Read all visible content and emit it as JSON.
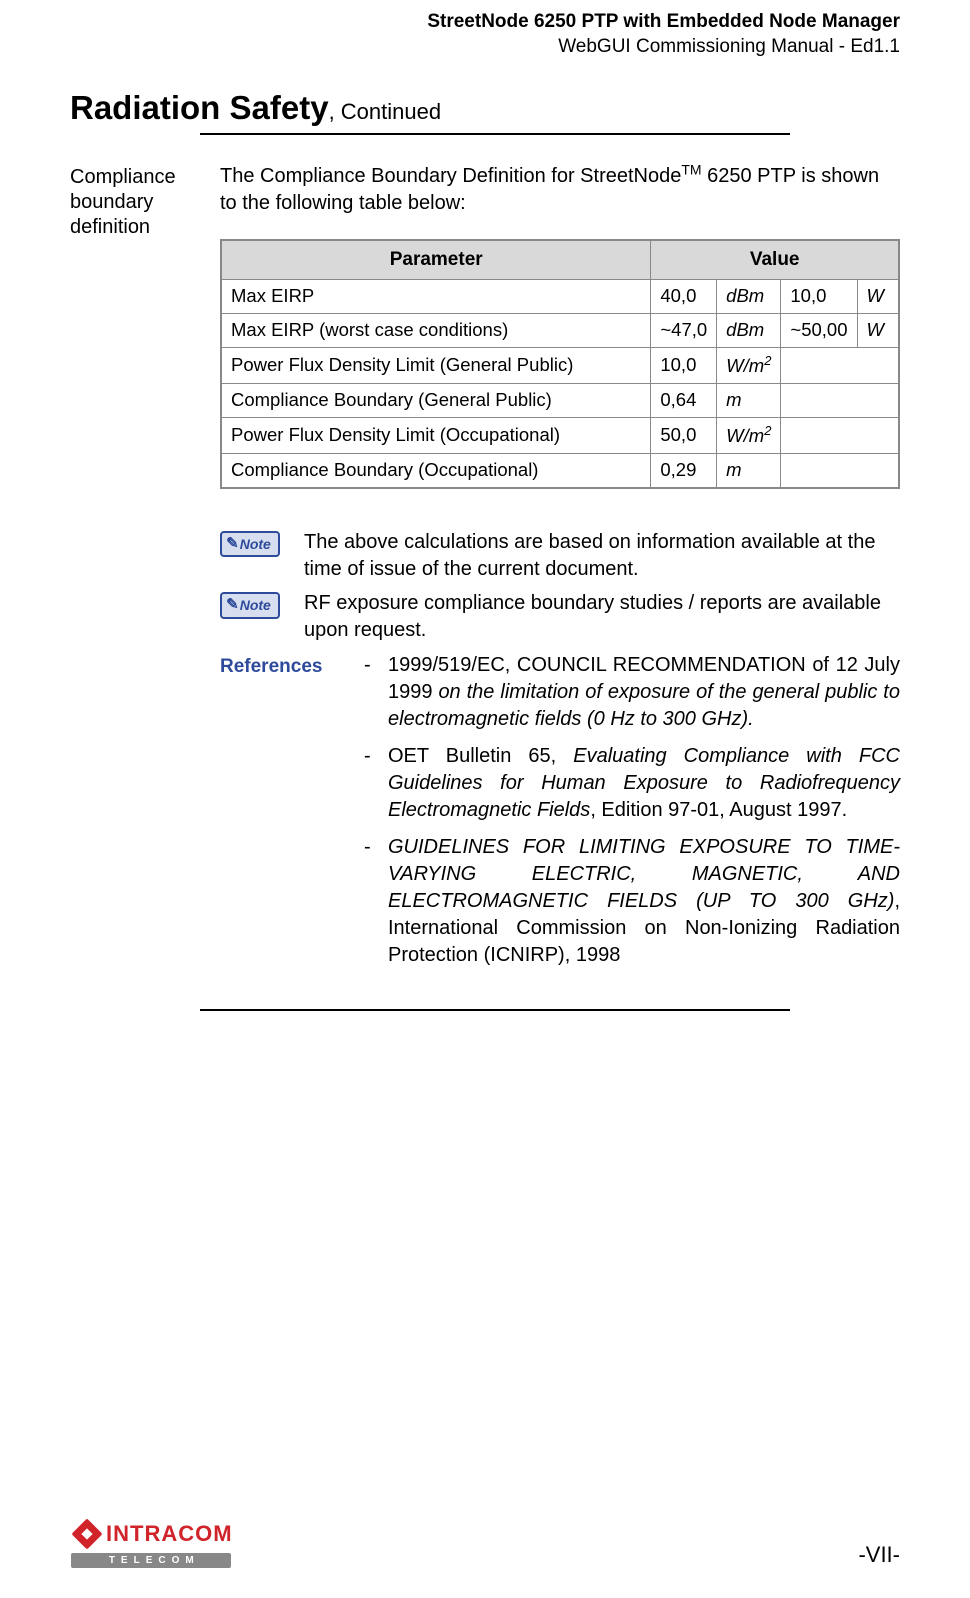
{
  "header": {
    "line1": "StreetNode 6250 PTP with Embedded Node Manager",
    "line2": "WebGUI Commissioning Manual - Ed1.1"
  },
  "section": {
    "title": "Radiation Safety",
    "suffix": ", Continued"
  },
  "side_label": "Compliance boundary definition",
  "intro_pre": "The Compliance Boundary Definition for StreetNode",
  "intro_tm": "TM",
  "intro_post": " 6250 PTP is shown to the following table below:",
  "table": {
    "head_param": "Parameter",
    "head_value": "Value",
    "rows": [
      {
        "param": "Max EIRP",
        "v1": "40,0",
        "u1": "dBm",
        "v2": "10,0",
        "u2": "W"
      },
      {
        "param": "Max EIRP (worst case conditions)",
        "v1": "~47,0",
        "u1": "dBm",
        "v2": "~50,00",
        "u2": "W"
      },
      {
        "param": "Power Flux Density Limit (General Public)",
        "v1": "10,0",
        "u1": "W/m2",
        "v2": "",
        "u2": ""
      },
      {
        "param": "Compliance Boundary (General Public)",
        "v1": "0,64",
        "u1": "m",
        "v2": "",
        "u2": ""
      },
      {
        "param": "Power Flux Density Limit (Occupational)",
        "v1": "50,0",
        "u1": "W/m2",
        "v2": "",
        "u2": ""
      },
      {
        "param": "Compliance Boundary (Occupational)",
        "v1": "0,29",
        "u1": "m",
        "v2": "",
        "u2": ""
      }
    ]
  },
  "notes": {
    "badge": "Note",
    "note1": "The above calculations are based on information available at the time of issue of the current document.",
    "note2": "RF exposure compliance boundary studies / reports are available upon request."
  },
  "references": {
    "label": "References",
    "items": [
      {
        "plain_pre": "1999/519/EC, COUNCIL RECOMMENDATION of 12 July 1999 ",
        "italic": "on the limitation of exposure of the general public to electromagnetic fields (0 Hz to 300 GHz).",
        "plain_post": ""
      },
      {
        "plain_pre": "OET Bulletin 65, ",
        "italic": "Evaluating Compliance with FCC Guidelines for Human Exposure to Radiofrequency Electromagnetic Fields",
        "plain_post": ", Edition 97-01, August 1997."
      },
      {
        "plain_pre": "",
        "italic": "GUIDELINES FOR LIMITING EXPOSURE TO TIME-VARYING ELECTRIC, MAGNETIC, AND ELECTROMAGNETIC FIELDS (UP TO 300 GHz)",
        "plain_post": ", International Commission on Non-Ionizing Radiation Protection (ICNIRP), 1998"
      }
    ]
  },
  "footer": {
    "logo_main": "INTRACOM",
    "logo_sub": "TELECOM",
    "page": "-VII-"
  }
}
